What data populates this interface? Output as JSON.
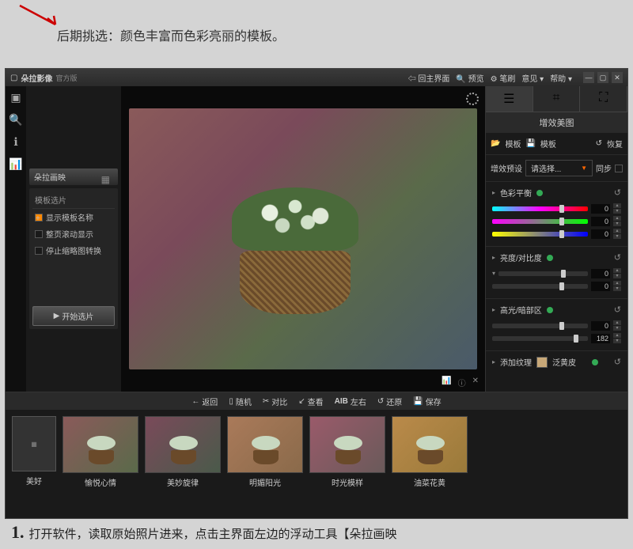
{
  "annotation": "后期挑选：颜色丰富而色彩亮丽的模板。",
  "app": {
    "name": "朵拉影像",
    "edition": "官方版"
  },
  "titlebar": {
    "home": "回主界面",
    "preview": "预览",
    "brush": "笔刷",
    "feedback": "意见",
    "help": "帮助"
  },
  "leftPanel": {
    "header": "朵拉画映",
    "subheader": "模板选片",
    "opt1": "显示模板名称",
    "opt2": "整页滚动显示",
    "opt3": "停止缩略图转换",
    "startBtn": "开始选片"
  },
  "rightPanel": {
    "title": "增效美图",
    "templateOpen": "模板",
    "templateSave": "模板",
    "restore": "恢复",
    "presetLabel": "增效预设",
    "presetValue": "请选择...",
    "sync": "同步",
    "group1": "色彩平衡",
    "group2": "亮度/对比度",
    "group3": "高光/暗部区",
    "group4": "添加纹理",
    "texture": "泛黄皮",
    "val0": "0",
    "val182": "182"
  },
  "bottomBar": {
    "back": "返回",
    "random": "随机",
    "compare": "对比",
    "view": "查看",
    "ab": "AIB",
    "lr": "左右",
    "restore": "还原",
    "save": "保存"
  },
  "thumbs": {
    "orig": "美好",
    "p1": "愉悦心情",
    "p2": "美妙旋律",
    "p3": "明媚阳光",
    "p4": "时光模样",
    "p5": "油菜花黄"
  },
  "step": {
    "num": "1.",
    "text": "打开软件，读取原始照片进来，点击主界面左边的浮动工具【朵拉画映"
  }
}
